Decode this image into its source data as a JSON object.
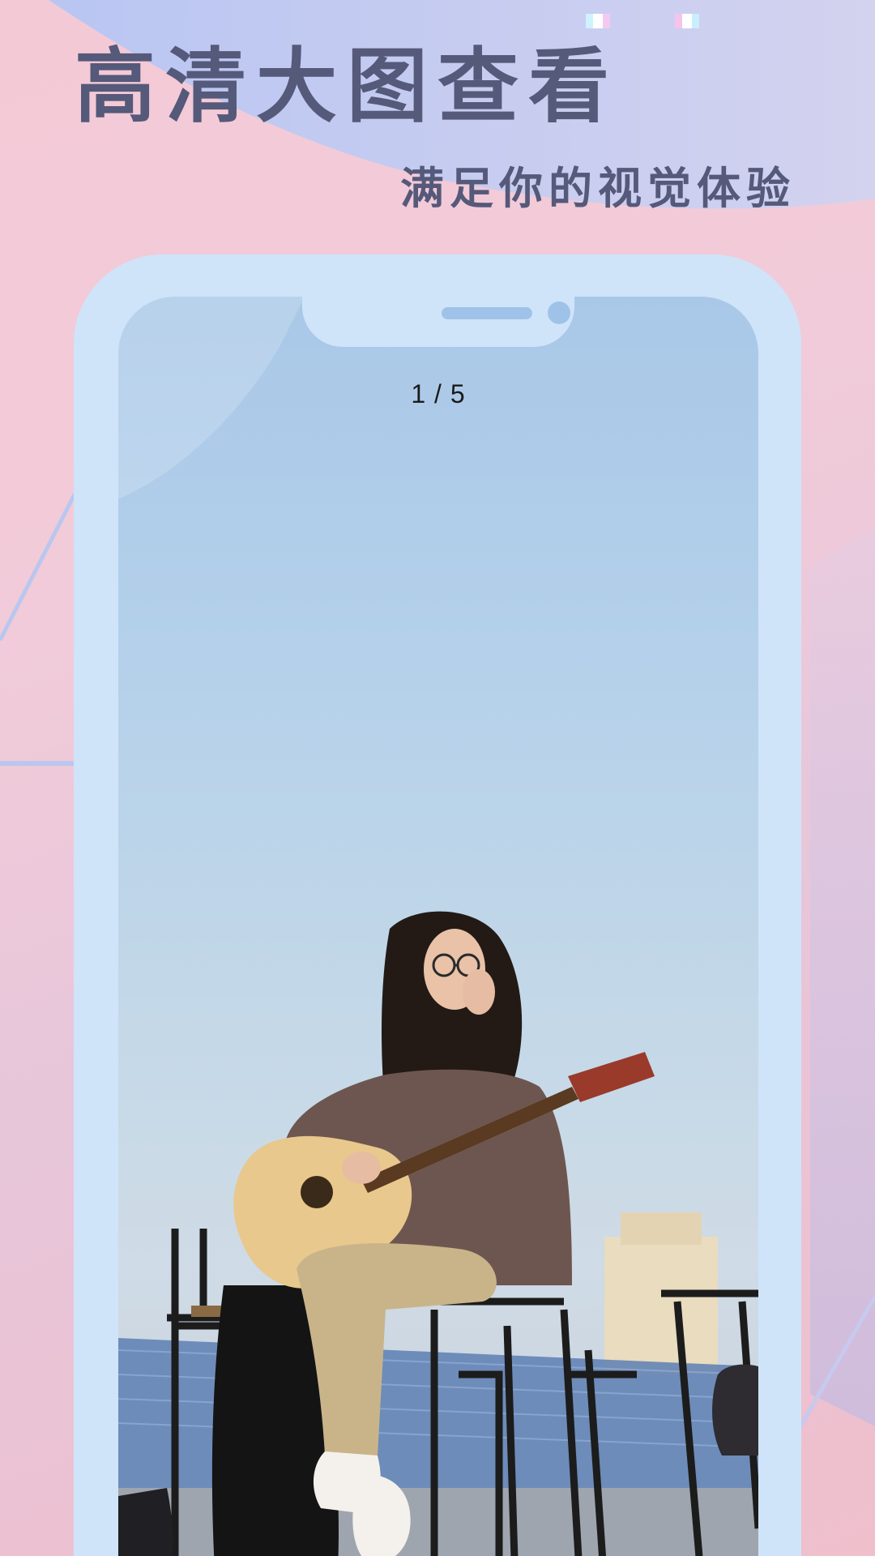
{
  "header": {
    "title": "高清大图查看",
    "subtitle": "满足你的视觉体验"
  },
  "viewer": {
    "page_counter": "1 / 5",
    "current_page": 1,
    "total_pages": 5
  },
  "colors": {
    "heading": "#55597a",
    "phone_frame": "#cfe4f9",
    "background_pink": "#f4c9d6",
    "background_blue": "#c8d4f2"
  }
}
